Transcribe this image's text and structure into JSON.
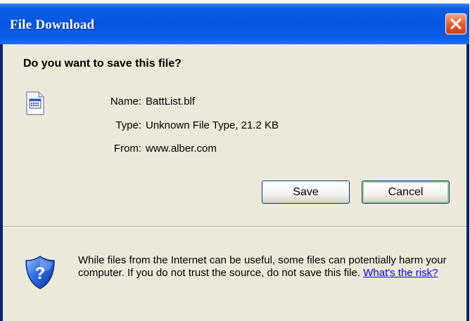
{
  "window": {
    "title": "File Download",
    "close_icon": "close-icon"
  },
  "dialog": {
    "question": "Do you want to save this file?",
    "file_icon": "document-icon",
    "info": {
      "name_label": "Name:",
      "name_value": "BattList.blf",
      "type_label": "Type:",
      "type_value": "Unknown File Type, 21.2 KB",
      "from_label": "From:",
      "from_value": "www.alber.com"
    },
    "buttons": {
      "save_label": "Save",
      "cancel_label": "Cancel"
    },
    "warning": {
      "icon": "shield-question-icon",
      "text": "While files from the Internet can be useful, some files can potentially harm your computer. If you do not trust the source, do not save this file.",
      "link_text": "What's the risk?"
    }
  },
  "colors": {
    "titlebar": "#0656e0",
    "dialog_bg": "#ece9d8",
    "close_button": "#e55a2b",
    "link": "#0000ee"
  }
}
